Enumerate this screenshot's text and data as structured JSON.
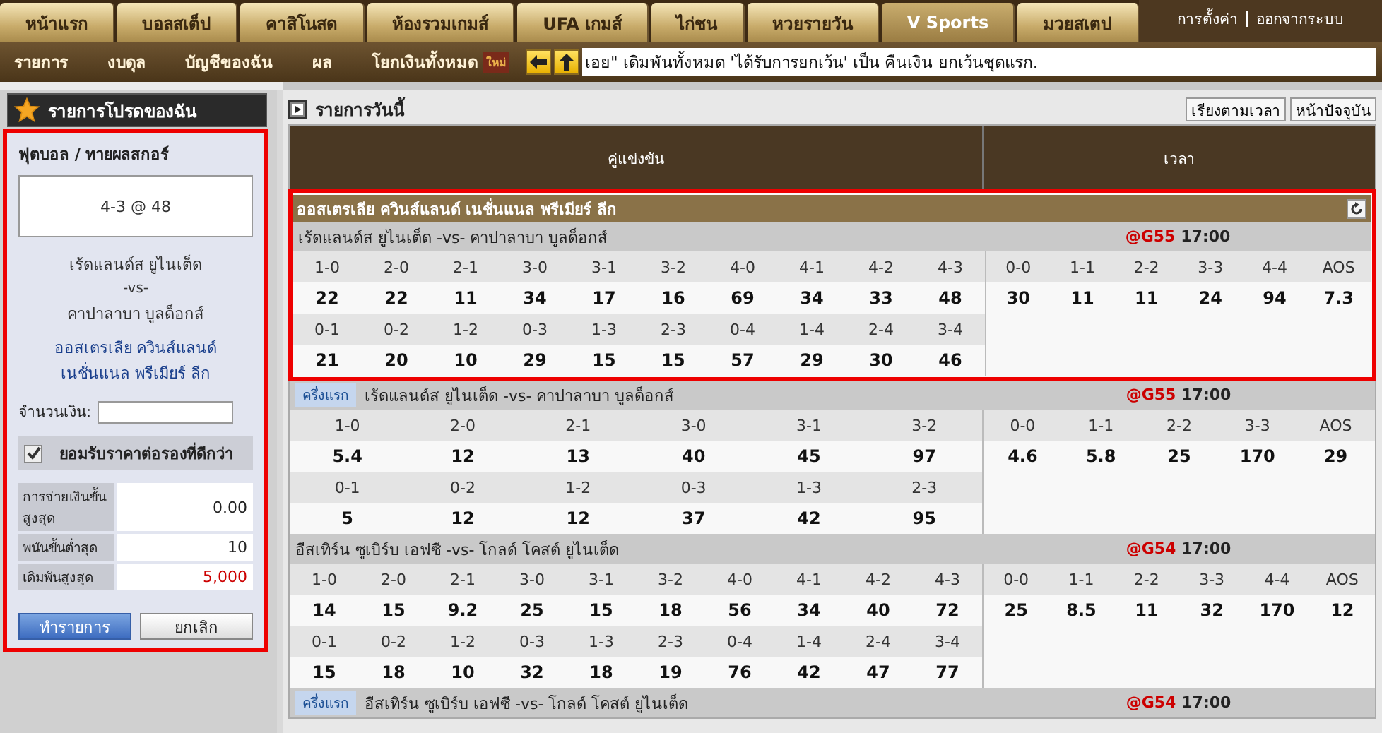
{
  "nav": {
    "tabs": [
      {
        "label": "หน้าแรก",
        "selected": false
      },
      {
        "label": "บอลสเต็ป",
        "selected": false
      },
      {
        "label": "คาสิโนสด",
        "selected": false
      },
      {
        "label": "ห้องรวมเกมส์",
        "selected": false
      },
      {
        "label": "UFA เกมส์",
        "selected": false
      },
      {
        "label": "ไก่ชน",
        "selected": false
      },
      {
        "label": "หวยรายวัน",
        "selected": false
      },
      {
        "label": "V Sports",
        "selected": true
      },
      {
        "label": "มวยสเตป",
        "selected": false
      }
    ],
    "account_links": [
      "การตั้งค่า",
      "ออกจากระบบ"
    ]
  },
  "subnav": {
    "items": [
      {
        "label": "รายการ"
      },
      {
        "label": "งบดุล"
      },
      {
        "label": "บัญชีของฉัน"
      },
      {
        "label": "ผล"
      },
      {
        "label": "โยกเงินทั้งหมด",
        "badge": "ใหม่"
      }
    ],
    "ticker": "เอย\" เดิมพันทั้งหมด 'ได้รับการยกเว้น' เป็น คืนเงิน ยกเว้นชุดแรก."
  },
  "favorites": {
    "title": "รายการโปรดของฉัน"
  },
  "bet_slip": {
    "highlighted": true,
    "heading": "ฟุตบอล / ทายผลสกอร์",
    "selection": "4-3  @ 48",
    "home": "เร้ดแลนด์ส ยูไนเต็ด",
    "vs": "-vs-",
    "away": "คาปาลาบา บูลด็อกส์",
    "league": "ออสเตรเลีย ควินส์แลนด์ เนชั่นแนล พรีเมียร์ ลีก",
    "amount_label": "จำนวนเงิน:",
    "accept_better_odds": {
      "label": "ยอมรับราคาต่อรองที่ดีกว่า",
      "checked": true
    },
    "limits": [
      {
        "label": "การจ่ายเงินขั้นสูงสุด",
        "value": "0.00",
        "emphasis": false
      },
      {
        "label": "พนันขั้นต่ำสุด",
        "value": "10",
        "emphasis": false
      },
      {
        "label": "เดิมพันสูงสุด",
        "value": "5,000",
        "emphasis": true
      }
    ],
    "buttons": [
      {
        "label": "ทำรายการ",
        "kind": "primary"
      },
      {
        "label": "ยกเลิก",
        "kind": "secondary"
      }
    ]
  },
  "today": {
    "title": "รายการวันนี้",
    "buttons": [
      "เรียงตามเวลา",
      "หน้าปัจจุบัน"
    ],
    "columns": [
      "คู่แข่งขัน",
      "เวลา"
    ],
    "leagues": [
      {
        "name": "ออสเตรเลีย ควินส์แลนด์ เนชั่นแนล พรีเมียร์ ลีก",
        "highlighted": true,
        "matches": [
          {
            "teams": "เร้ดแลนด์ส ยูไนเต็ด  -vs- คาปาลาบา บูลด็อกส์",
            "code": "@G55",
            "time": "17:00",
            "score_rows": [
              [
                {
                  "score": "1-0",
                  "odds": "22"
                },
                {
                  "score": "2-0",
                  "odds": "22"
                },
                {
                  "score": "2-1",
                  "odds": "11"
                },
                {
                  "score": "3-0",
                  "odds": "34"
                },
                {
                  "score": "3-1",
                  "odds": "17"
                },
                {
                  "score": "3-2",
                  "odds": "16"
                },
                {
                  "score": "4-0",
                  "odds": "69"
                },
                {
                  "score": "4-1",
                  "odds": "34"
                },
                {
                  "score": "4-2",
                  "odds": "33"
                },
                {
                  "score": "4-3",
                  "odds": "48"
                }
              ],
              [
                {
                  "score": "0-1",
                  "odds": "21"
                },
                {
                  "score": "0-2",
                  "odds": "20"
                },
                {
                  "score": "1-2",
                  "odds": "10"
                },
                {
                  "score": "0-3",
                  "odds": "29"
                },
                {
                  "score": "1-3",
                  "odds": "15"
                },
                {
                  "score": "2-3",
                  "odds": "15"
                },
                {
                  "score": "0-4",
                  "odds": "57"
                },
                {
                  "score": "1-4",
                  "odds": "29"
                },
                {
                  "score": "2-4",
                  "odds": "30"
                },
                {
                  "score": "3-4",
                  "odds": "46"
                }
              ]
            ],
            "draw_row": [
              {
                "score": "0-0",
                "odds": "30"
              },
              {
                "score": "1-1",
                "odds": "11"
              },
              {
                "score": "2-2",
                "odds": "11"
              },
              {
                "score": "3-3",
                "odds": "24"
              },
              {
                "score": "4-4",
                "odds": "94"
              },
              {
                "score": "AOS",
                "odds": "7.3"
              }
            ]
          },
          {
            "period": "ครึ่งแรก",
            "teams": "เร้ดแลนด์ส ยูไนเต็ด  -vs- คาปาลาบา บูลด็อกส์",
            "code": "@G55",
            "time": "17:00",
            "score_rows": [
              [
                {
                  "score": "1-0",
                  "odds": "5.4"
                },
                {
                  "score": "2-0",
                  "odds": "12"
                },
                {
                  "score": "2-1",
                  "odds": "13"
                },
                {
                  "score": "3-0",
                  "odds": "40"
                },
                {
                  "score": "3-1",
                  "odds": "45"
                },
                {
                  "score": "3-2",
                  "odds": "97"
                }
              ],
              [
                {
                  "score": "0-1",
                  "odds": "5"
                },
                {
                  "score": "0-2",
                  "odds": "12"
                },
                {
                  "score": "1-2",
                  "odds": "12"
                },
                {
                  "score": "0-3",
                  "odds": "37"
                },
                {
                  "score": "1-3",
                  "odds": "42"
                },
                {
                  "score": "2-3",
                  "odds": "95"
                }
              ]
            ],
            "draw_row": [
              {
                "score": "0-0",
                "odds": "4.6"
              },
              {
                "score": "1-1",
                "odds": "5.8"
              },
              {
                "score": "2-2",
                "odds": "25"
              },
              {
                "score": "3-3",
                "odds": "170"
              },
              {
                "score": "AOS",
                "odds": "29"
              }
            ]
          },
          {
            "teams": "อีสเทิร์น ซูเบิร์บ เอฟซี  -vs- โกลด์ โคสต์ ยูไนเต็ด",
            "code": "@G54",
            "time": "17:00",
            "score_rows": [
              [
                {
                  "score": "1-0",
                  "odds": "14"
                },
                {
                  "score": "2-0",
                  "odds": "15"
                },
                {
                  "score": "2-1",
                  "odds": "9.2"
                },
                {
                  "score": "3-0",
                  "odds": "25"
                },
                {
                  "score": "3-1",
                  "odds": "15"
                },
                {
                  "score": "3-2",
                  "odds": "18"
                },
                {
                  "score": "4-0",
                  "odds": "56"
                },
                {
                  "score": "4-1",
                  "odds": "34"
                },
                {
                  "score": "4-2",
                  "odds": "40"
                },
                {
                  "score": "4-3",
                  "odds": "72"
                }
              ],
              [
                {
                  "score": "0-1",
                  "odds": "15"
                },
                {
                  "score": "0-2",
                  "odds": "18"
                },
                {
                  "score": "1-2",
                  "odds": "10"
                },
                {
                  "score": "0-3",
                  "odds": "32"
                },
                {
                  "score": "1-3",
                  "odds": "18"
                },
                {
                  "score": "2-3",
                  "odds": "19"
                },
                {
                  "score": "0-4",
                  "odds": "76"
                },
                {
                  "score": "1-4",
                  "odds": "42"
                },
                {
                  "score": "2-4",
                  "odds": "47"
                },
                {
                  "score": "3-4",
                  "odds": "77"
                }
              ]
            ],
            "draw_row": [
              {
                "score": "0-0",
                "odds": "25"
              },
              {
                "score": "1-1",
                "odds": "8.5"
              },
              {
                "score": "2-2",
                "odds": "11"
              },
              {
                "score": "3-3",
                "odds": "32"
              },
              {
                "score": "4-4",
                "odds": "170"
              },
              {
                "score": "AOS",
                "odds": "12"
              }
            ]
          },
          {
            "period": "ครึ่งแรก",
            "teams": "อีสเทิร์น ซูเบิร์บ เอฟซี  -vs- โกลด์ โคสต์ ยูไนเต็ด",
            "code": "@G54",
            "time": "17:00"
          }
        ]
      }
    ]
  }
}
